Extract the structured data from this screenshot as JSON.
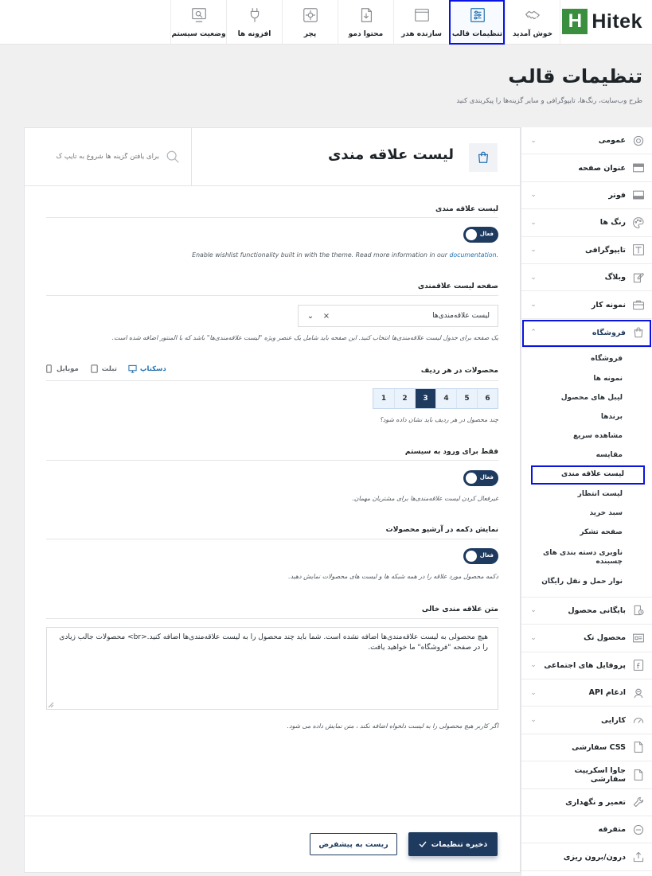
{
  "brand": {
    "logo_letter": "H",
    "logo_text": "Hitek",
    "accent": "#1e3a5f",
    "logo_color": "#3a8f3f",
    "highlight": "#0a14e0"
  },
  "topnav": [
    {
      "key": "welcome",
      "label": "خوش آمدید",
      "icon": "handshake-icon"
    },
    {
      "key": "theme-settings",
      "label": "تنظیمات قالب",
      "icon": "sliders-icon",
      "active": true
    },
    {
      "key": "header-builder",
      "label": "سازنده هدر",
      "icon": "window-icon"
    },
    {
      "key": "demo-content",
      "label": "محتوا دمو",
      "icon": "document-icon"
    },
    {
      "key": "patcher",
      "label": "پچر",
      "icon": "gear-box-icon"
    },
    {
      "key": "plugins",
      "label": "افزونه ها",
      "icon": "plug-icon"
    },
    {
      "key": "system-status",
      "label": "وضعیت سیستم",
      "icon": "monitor-icon"
    }
  ],
  "page": {
    "title": "تنظیمات قالب",
    "subtitle": "طرح وب‌سایت، رنگ‌ها، تایپوگرافی و سایر گزینه‌ها را پیکربندی کنید"
  },
  "sidebar": {
    "items_top": [
      {
        "label": "عمومی",
        "icon": "gear-icon",
        "chevron": true
      },
      {
        "label": "عنوان صفحه",
        "icon": "title-bar-icon",
        "chevron": false
      },
      {
        "label": "فوتر",
        "icon": "footer-icon",
        "chevron": true
      },
      {
        "label": "رنگ ها",
        "icon": "palette-icon",
        "chevron": true
      },
      {
        "label": "تایپوگرافی",
        "icon": "typography-icon",
        "chevron": true
      },
      {
        "label": "وبلاگ",
        "icon": "pencil-note-icon",
        "chevron": true
      },
      {
        "label": "نمونه کار",
        "icon": "briefcase-icon",
        "chevron": true
      }
    ],
    "shop": {
      "label": "فروشگاه",
      "icon": "shopping-bag-icon"
    },
    "shop_sub": [
      {
        "label": "فروشگاه"
      },
      {
        "label": "نمونه ها"
      },
      {
        "label": "لیبل های محصول"
      },
      {
        "label": "برندها"
      },
      {
        "label": "مشاهده سریع"
      },
      {
        "label": "مقایسه"
      },
      {
        "label": "لیست علاقه مندی",
        "active": true
      },
      {
        "label": "لیست انتظار"
      },
      {
        "label": "سبد خرید"
      },
      {
        "label": "صفحه تشکر"
      },
      {
        "label": "ناوبری دسته بندی های چسبنده",
        "two": true
      },
      {
        "label": "نوار حمل و نقل رایگان"
      }
    ],
    "items_bottom": [
      {
        "label": "بایگانی محصول",
        "icon": "archive-clock-icon",
        "chevron": true
      },
      {
        "label": "محصول تک",
        "icon": "product-icon",
        "chevron": true
      },
      {
        "label": "پروفایل های اجتماعی",
        "icon": "social-icon",
        "chevron": true
      },
      {
        "label": "ادغام API",
        "icon": "api-icon",
        "chevron": true
      },
      {
        "label": "کارایی",
        "icon": "speedometer-icon",
        "chevron": true
      },
      {
        "label": "CSS سفارشی",
        "icon": "css-file-icon",
        "chevron": false
      },
      {
        "label": "جاوا اسکریپت سفارشی",
        "icon": "js-file-icon",
        "chevron": false
      },
      {
        "label": "تعمیر و نگهداری",
        "icon": "wrench-icon",
        "chevron": false
      },
      {
        "label": "متفرقه",
        "icon": "minus-circle-icon",
        "chevron": false
      },
      {
        "label": "درون/برون ریزی",
        "icon": "import-export-icon",
        "chevron": false
      }
    ]
  },
  "panel": {
    "title": "لیست علاقه مندی",
    "search_placeholder": "برای یافتن گزینه ها شروع به تایپ ک",
    "wishlist": {
      "label": "لیست علاقه مندی",
      "toggle": "فعال",
      "desc_text": "Enable wishlist functionality built in with the theme. Read more information in our",
      "desc_link": "documentation",
      "desc_end": "."
    },
    "wishlist_page": {
      "label": "صفحه لیست علاقمندی",
      "value": "لیست علاقه‌مندی‌ها",
      "clear": "×",
      "caret": "⌄",
      "desc": "یک صفحه برای جدول لیست علاقه‌مندی‌ها انتخاب کنید. این صفحه باید شامل یک عنصر ویژه \"لیست علاقه‌مندی‌ها\" باشد که با المنتور اضافه شده است."
    },
    "per_row": {
      "label": "محصولات در هر ردیف",
      "devices": [
        {
          "label": "دسکتاپ",
          "icon": "desktop-icon",
          "active": true
        },
        {
          "label": "تبلت",
          "icon": "tablet-icon"
        },
        {
          "label": "موبایل",
          "icon": "mobile-icon"
        }
      ],
      "numbers": [
        "1",
        "2",
        "3",
        "4",
        "5",
        "6"
      ],
      "selected": "3",
      "desc": "چند محصول در هر ردیف باید نشان داده شود؟"
    },
    "logged_in": {
      "label": "فقط برای ورود به سیستم",
      "toggle": "فعال",
      "desc": "غیرفعال کردن لیست علاقه‌مندی‌ها برای مشتریان مهمان."
    },
    "archive_button": {
      "label": "نمایش دکمه در آرشیو محصولات",
      "toggle": "فعال",
      "desc": "دکمه محصول مورد علاقه را در همه شبکه ها و لیست های محصولات نمایش دهید."
    },
    "empty_text": {
      "label": "متن علاقه مندی خالی",
      "value": "هیچ محصولی به لیست علاقه‌مندی‌ها اضافه نشده است. شما باید چند محصول را به لیست علاقه‌مندی‌ها اضافه کنید.<br> محصولات جالب زیادی را در صفحه \"فروشگاه\" ما خواهید یافت.",
      "desc": "اگر کاربر هیچ محصولی را به لیست دلخواه اضافه نکند ، متن نمایش داده می شود."
    },
    "save_label": "ذخیره تنظیمات",
    "reset_label": "ریست به پیشفرض"
  }
}
